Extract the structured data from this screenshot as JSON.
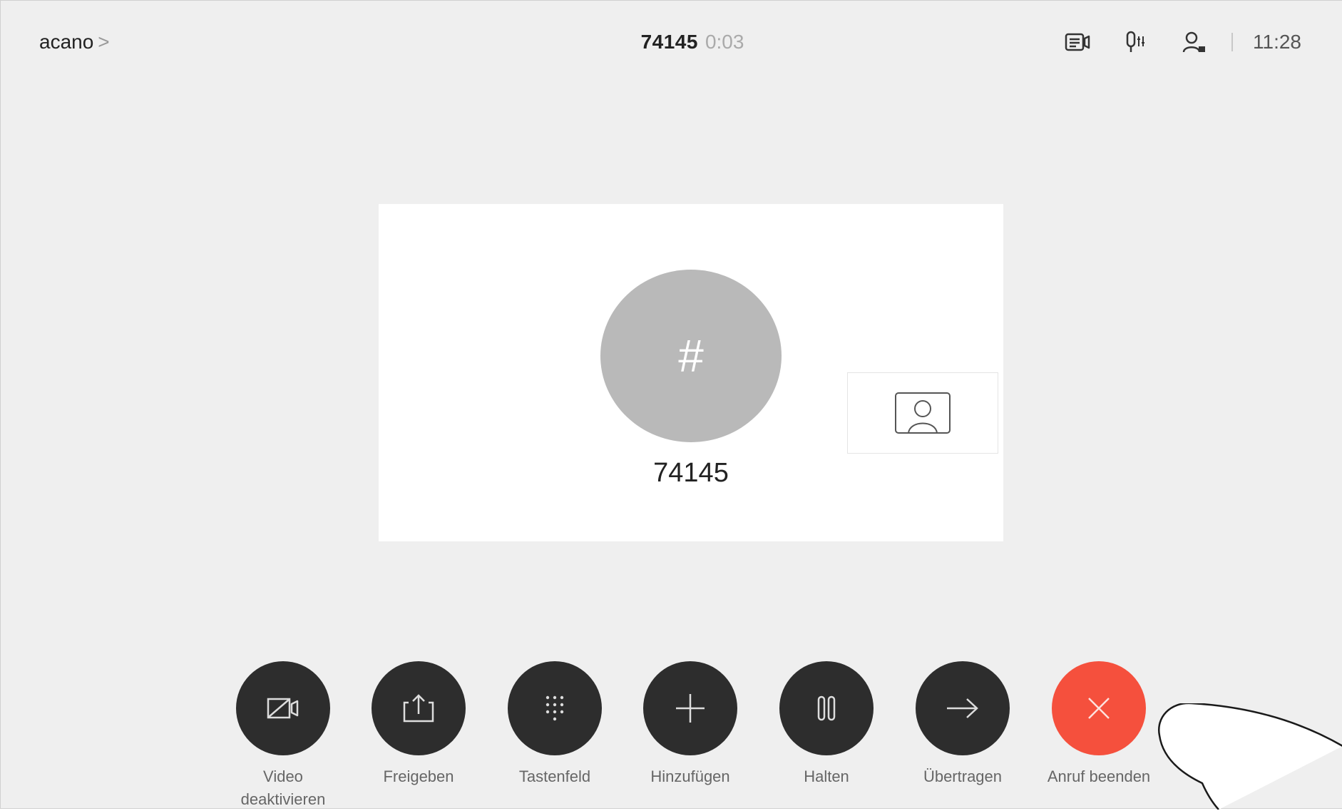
{
  "header": {
    "breadcrumb": "acano",
    "breadcrumb_chevron": ">",
    "call_number": "74145",
    "call_duration": "0:03",
    "clock": "11:28",
    "icons": [
      "camera-control-icon",
      "mic-settings-icon",
      "participants-icon"
    ]
  },
  "call": {
    "avatar_symbol": "#",
    "name": "74145",
    "self_view_icon": "person-icon"
  },
  "controls": [
    {
      "label": "Video\ndeaktivieren",
      "icon": "video-off-icon"
    },
    {
      "label": "Freigeben",
      "icon": "share-icon"
    },
    {
      "label": "Tastenfeld",
      "icon": "keypad-icon"
    },
    {
      "label": "Hinzufügen",
      "icon": "plus-icon"
    },
    {
      "label": "Halten",
      "icon": "pause-icon"
    },
    {
      "label": "Übertragen",
      "icon": "arrow-right-icon"
    },
    {
      "label": "Anruf beenden",
      "icon": "close-icon"
    }
  ],
  "colors": {
    "background": "#efefef",
    "button": "#2d2d2d",
    "end_call": "#f5503d",
    "avatar": "#b9b9b9"
  }
}
